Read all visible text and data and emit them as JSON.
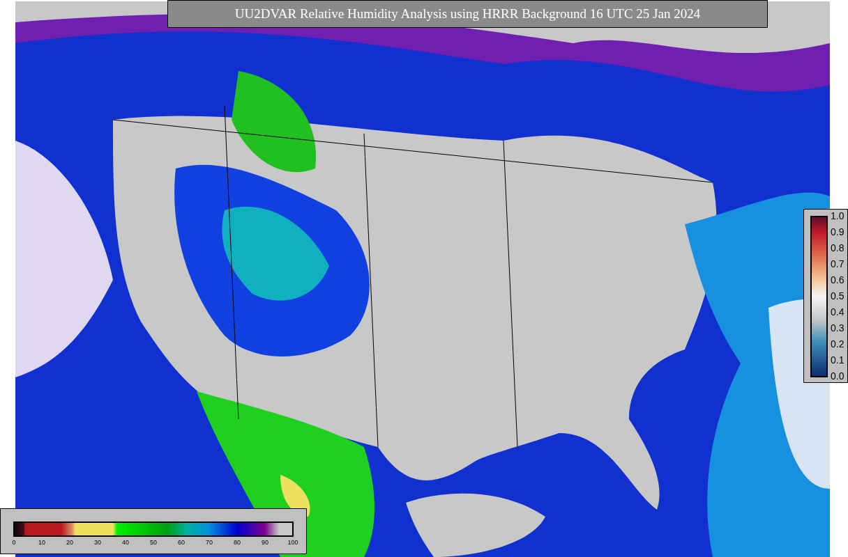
{
  "title": "UU2DVAR Relative Humidity Analysis using HRRR Background 16 UTC 25 Jan 2024",
  "right_colorbar": {
    "ticks": [
      "1.0",
      "0.9",
      "0.8",
      "0.7",
      "0.6",
      "0.5",
      "0.4",
      "0.3",
      "0.2",
      "0.1",
      "0.0"
    ]
  },
  "bottom_colorbar": {
    "ticks": [
      "0",
      "10",
      "20",
      "30",
      "40",
      "50",
      "60",
      "70",
      "80",
      "90",
      "100"
    ]
  }
}
